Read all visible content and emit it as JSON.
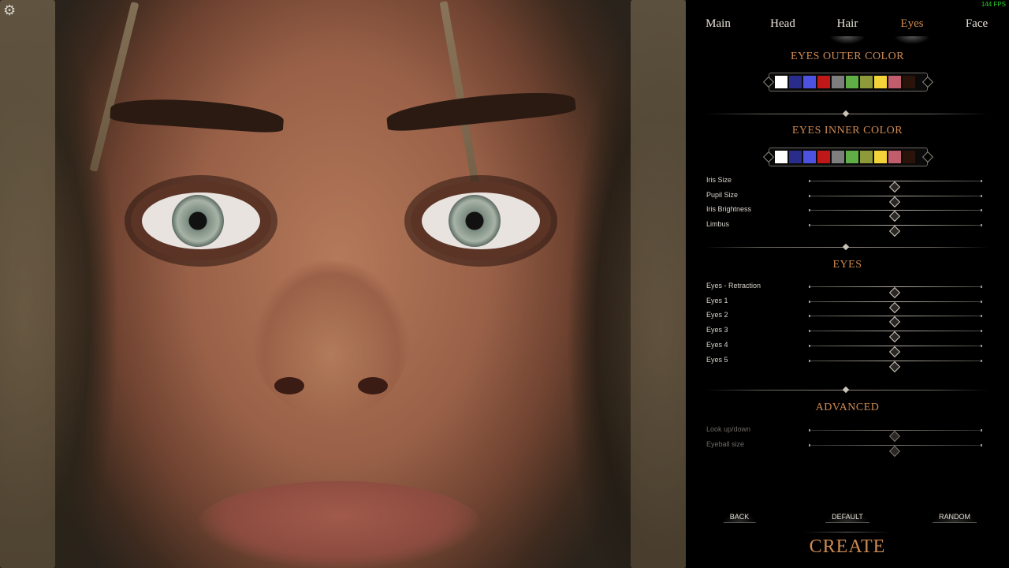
{
  "fps": "144 FPS",
  "tabs": [
    {
      "label": "Main",
      "active": false
    },
    {
      "label": "Head",
      "active": false
    },
    {
      "label": "Hair",
      "active": false
    },
    {
      "label": "Eyes",
      "active": true
    },
    {
      "label": "Face",
      "active": false
    }
  ],
  "colors": {
    "accent": "#cf8a52",
    "swatches": [
      "#ffffff",
      "#2a2c8c",
      "#4d52e0",
      "#c01818",
      "#7e7e7e",
      "#5fae46",
      "#8e9a3a",
      "#f2d43a",
      "#c25d6e",
      "#2a130b"
    ]
  },
  "outer_color": {
    "title": "EYES OUTER COLOR"
  },
  "inner_color": {
    "title": "EYES INNER COLOR"
  },
  "iris_sliders": [
    {
      "label": "Iris Size",
      "value": 0.5
    },
    {
      "label": "Pupil Size",
      "value": 0.5
    },
    {
      "label": "Iris Brightness",
      "value": 0.5
    },
    {
      "label": "Limbus",
      "value": 0.5
    }
  ],
  "eyes_section": {
    "title": "EYES",
    "sliders": [
      {
        "label": "Eyes - Retraction",
        "value": 0.5
      },
      {
        "label": "Eyes 1",
        "value": 0.5
      },
      {
        "label": "Eyes 2",
        "value": 0.5
      },
      {
        "label": "Eyes 3",
        "value": 0.5
      },
      {
        "label": "Eyes 4",
        "value": 0.5
      },
      {
        "label": "Eyes 5",
        "value": 0.5
      }
    ]
  },
  "advanced_section": {
    "title": "ADVANCED",
    "sliders": [
      {
        "label": "Look up/down",
        "value": 0.5
      },
      {
        "label": "Eyeball size",
        "value": 0.5
      }
    ]
  },
  "buttons": {
    "back": "BACK",
    "default": "DEFAULT",
    "random": "RANDOM",
    "create": "CREATE"
  },
  "icons": {
    "settings": "gear-icon"
  }
}
